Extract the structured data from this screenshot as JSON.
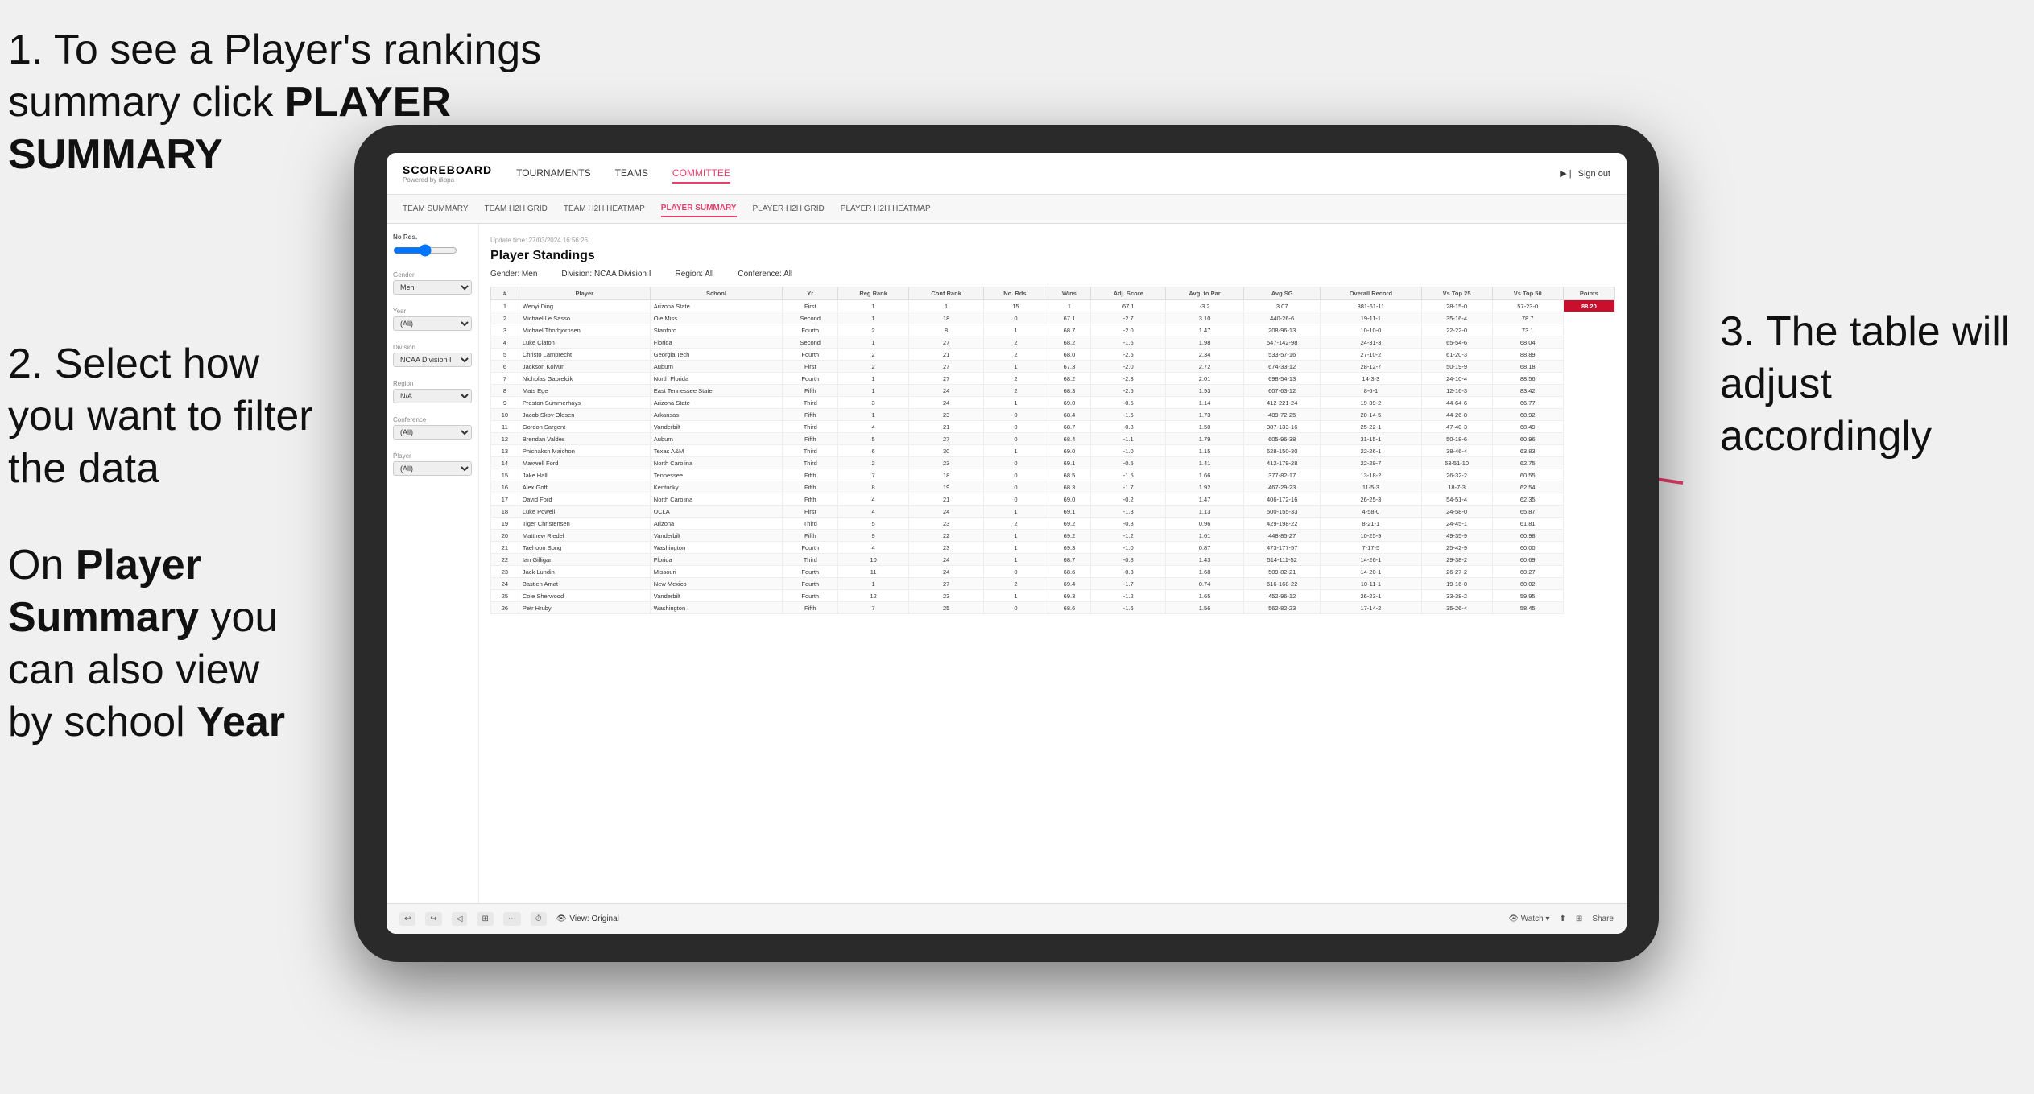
{
  "annotations": {
    "top_left": {
      "number": "1.",
      "text": "To see a Player's rankings summary click ",
      "bold": "PLAYER SUMMARY"
    },
    "mid_left": {
      "text": "2. Select how you want to filter the data"
    },
    "bottom_left": {
      "text": "On ",
      "bold1": "Player Summary",
      "text2": " you can also view by school ",
      "bold2": "Year"
    },
    "right": {
      "number": "3.",
      "text": "The table will adjust accordingly"
    }
  },
  "nav": {
    "logo": "SCOREBOARD",
    "logo_sub": "Powered by dippa",
    "items": [
      "TOURNAMENTS",
      "TEAMS",
      "COMMITTEE"
    ],
    "active": "COMMITTEE",
    "right": [
      "Sign out"
    ]
  },
  "sub_nav": {
    "items": [
      "TEAM SUMMARY",
      "TEAM H2H GRID",
      "TEAM H2H HEATMAP",
      "PLAYER SUMMARY",
      "PLAYER H2H GRID",
      "PLAYER H2H HEATMAP"
    ],
    "active": "PLAYER SUMMARY"
  },
  "sidebar": {
    "no_rds_label": "No Rds.",
    "gender_label": "Gender",
    "gender_value": "Men",
    "year_label": "Year",
    "year_value": "(All)",
    "division_label": "Division",
    "division_value": "NCAA Division I",
    "region_label": "Region",
    "region_value": "N/A",
    "conference_label": "Conference",
    "conference_value": "(All)",
    "player_label": "Player",
    "player_value": "(All)"
  },
  "table": {
    "title": "Player Standings",
    "update_time": "Update time: 27/03/2024 16:56:26",
    "filters": {
      "gender_label": "Gender:",
      "gender_value": "Men",
      "division_label": "Division:",
      "division_value": "NCAA Division I",
      "region_label": "Region:",
      "region_value": "All",
      "conference_label": "Conference:",
      "conference_value": "All"
    },
    "columns": [
      "#",
      "Player",
      "School",
      "Yr",
      "Reg Rank",
      "Conf Rank",
      "No. Rds.",
      "Wins",
      "Adj. Score",
      "Avg. to Par",
      "Avg SG",
      "Overall Record",
      "Vs Top 25",
      "Vs Top 50",
      "Points"
    ],
    "rows": [
      [
        "1",
        "Wenyi Ding",
        "Arizona State",
        "First",
        "1",
        "1",
        "15",
        "1",
        "67.1",
        "-3.2",
        "3.07",
        "381-61-11",
        "28-15-0",
        "57-23-0",
        "88.20"
      ],
      [
        "2",
        "Michael Le Sasso",
        "Ole Miss",
        "Second",
        "1",
        "18",
        "0",
        "67.1",
        "-2.7",
        "3.10",
        "440-26-6",
        "19-11-1",
        "35-16-4",
        "78.7"
      ],
      [
        "3",
        "Michael Thorbjornsen",
        "Stanford",
        "Fourth",
        "2",
        "8",
        "1",
        "68.7",
        "-2.0",
        "1.47",
        "208-96-13",
        "10-10-0",
        "22-22-0",
        "73.1"
      ],
      [
        "4",
        "Luke Claton",
        "Florida",
        "Second",
        "1",
        "27",
        "2",
        "68.2",
        "-1.6",
        "1.98",
        "547-142-98",
        "24-31-3",
        "65-54-6",
        "68.04"
      ],
      [
        "5",
        "Christo Lamprecht",
        "Georgia Tech",
        "Fourth",
        "2",
        "21",
        "2",
        "68.0",
        "-2.5",
        "2.34",
        "533-57-16",
        "27-10-2",
        "61-20-3",
        "88.89"
      ],
      [
        "6",
        "Jackson Koivun",
        "Auburn",
        "First",
        "2",
        "27",
        "1",
        "67.3",
        "-2.0",
        "2.72",
        "674-33-12",
        "28-12-7",
        "50-19-9",
        "68.18"
      ],
      [
        "7",
        "Nicholas Gabrelcik",
        "North Florida",
        "Fourth",
        "1",
        "27",
        "2",
        "68.2",
        "-2.3",
        "2.01",
        "698-54-13",
        "14-3-3",
        "24-10-4",
        "88.56"
      ],
      [
        "8",
        "Mats Ege",
        "East Tennessee State",
        "Fifth",
        "1",
        "24",
        "2",
        "68.3",
        "-2.5",
        "1.93",
        "607-63-12",
        "8-6-1",
        "12-16-3",
        "83.42"
      ],
      [
        "9",
        "Preston Summerhays",
        "Arizona State",
        "Third",
        "3",
        "24",
        "1",
        "69.0",
        "-0.5",
        "1.14",
        "412-221-24",
        "19-39-2",
        "44-64-6",
        "66.77"
      ],
      [
        "10",
        "Jacob Skov Olesen",
        "Arkansas",
        "Fifth",
        "1",
        "23",
        "0",
        "68.4",
        "-1.5",
        "1.73",
        "489-72-25",
        "20-14-5",
        "44-26-8",
        "68.92"
      ],
      [
        "11",
        "Gordon Sargent",
        "Vanderbilt",
        "Third",
        "4",
        "21",
        "0",
        "68.7",
        "-0.8",
        "1.50",
        "387-133-16",
        "25-22-1",
        "47-40-3",
        "68.49"
      ],
      [
        "12",
        "Brendan Valdes",
        "Auburn",
        "Fifth",
        "5",
        "27",
        "0",
        "68.4",
        "-1.1",
        "1.79",
        "605-96-38",
        "31-15-1",
        "50-18-6",
        "60.96"
      ],
      [
        "13",
        "Phichaksn Maichon",
        "Texas A&M",
        "Third",
        "6",
        "30",
        "1",
        "69.0",
        "-1.0",
        "1.15",
        "628-150-30",
        "22-26-1",
        "38-46-4",
        "63.83"
      ],
      [
        "14",
        "Maxwell Ford",
        "North Carolina",
        "Third",
        "2",
        "23",
        "0",
        "69.1",
        "-0.5",
        "1.41",
        "412-179-28",
        "22-29-7",
        "53-51-10",
        "62.75"
      ],
      [
        "15",
        "Jake Hall",
        "Tennessee",
        "Fifth",
        "7",
        "18",
        "0",
        "68.5",
        "-1.5",
        "1.66",
        "377-82-17",
        "13-18-2",
        "26-32-2",
        "60.55"
      ],
      [
        "16",
        "Alex Goff",
        "Kentucky",
        "Fifth",
        "8",
        "19",
        "0",
        "68.3",
        "-1.7",
        "1.92",
        "467-29-23",
        "11-5-3",
        "18-7-3",
        "62.54"
      ],
      [
        "17",
        "David Ford",
        "North Carolina",
        "Fifth",
        "4",
        "21",
        "0",
        "69.0",
        "-0.2",
        "1.47",
        "406-172-16",
        "26-25-3",
        "54-51-4",
        "62.35"
      ],
      [
        "18",
        "Luke Powell",
        "UCLA",
        "First",
        "4",
        "24",
        "1",
        "69.1",
        "-1.8",
        "1.13",
        "500-155-33",
        "4-58-0",
        "24-58-0",
        "65.87"
      ],
      [
        "19",
        "Tiger Christensen",
        "Arizona",
        "Third",
        "5",
        "23",
        "2",
        "69.2",
        "-0.8",
        "0.96",
        "429-198-22",
        "8-21-1",
        "24-45-1",
        "61.81"
      ],
      [
        "20",
        "Matthew Riedel",
        "Vanderbilt",
        "Fifth",
        "9",
        "22",
        "1",
        "69.2",
        "-1.2",
        "1.61",
        "448-85-27",
        "10-25-9",
        "49-35-9",
        "60.98"
      ],
      [
        "21",
        "Taehoon Song",
        "Washington",
        "Fourth",
        "4",
        "23",
        "1",
        "69.3",
        "-1.0",
        "0.87",
        "473-177-57",
        "7-17-5",
        "25-42-9",
        "60.00"
      ],
      [
        "22",
        "Ian Gilligan",
        "Florida",
        "Third",
        "10",
        "24",
        "1",
        "68.7",
        "-0.8",
        "1.43",
        "514-111-52",
        "14-26-1",
        "29-38-2",
        "60.69"
      ],
      [
        "23",
        "Jack Lundin",
        "Missouri",
        "Fourth",
        "11",
        "24",
        "0",
        "68.6",
        "-0.3",
        "1.68",
        "509-82-21",
        "14-20-1",
        "26-27-2",
        "60.27"
      ],
      [
        "24",
        "Bastien Amat",
        "New Mexico",
        "Fourth",
        "1",
        "27",
        "2",
        "69.4",
        "-1.7",
        "0.74",
        "616-168-22",
        "10-11-1",
        "19-16-0",
        "60.02"
      ],
      [
        "25",
        "Cole Sherwood",
        "Vanderbilt",
        "Fourth",
        "12",
        "23",
        "1",
        "69.3",
        "-1.2",
        "1.65",
        "452-96-12",
        "26-23-1",
        "33-38-2",
        "59.95"
      ],
      [
        "26",
        "Petr Hruby",
        "Washington",
        "Fifth",
        "7",
        "25",
        "0",
        "68.6",
        "-1.6",
        "1.56",
        "562-82-23",
        "17-14-2",
        "35-26-4",
        "58.45"
      ]
    ]
  },
  "toolbar": {
    "view_label": "View: Original",
    "watch_label": "Watch",
    "share_label": "Share"
  }
}
